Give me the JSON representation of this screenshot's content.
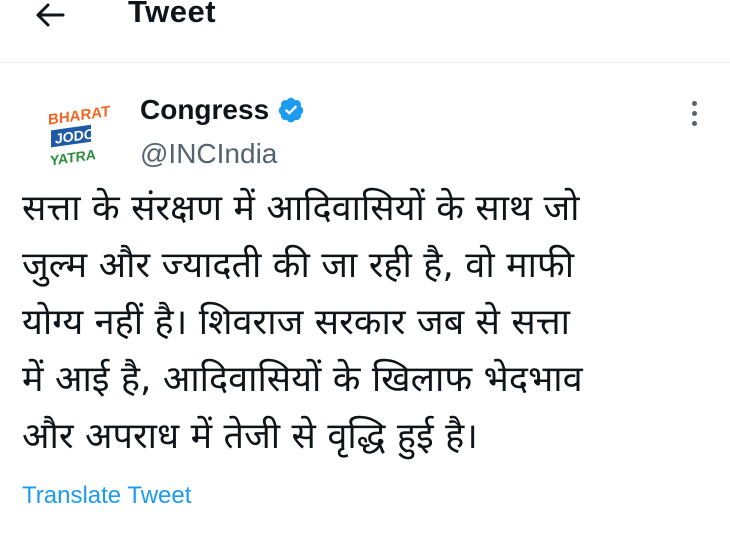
{
  "header": {
    "back_icon": "arrow-left-icon",
    "title": "Tweet"
  },
  "tweet": {
    "avatar": {
      "logo_text": [
        "BHARAT",
        "JODO",
        "YATRA"
      ],
      "colors": {
        "orange": "#f26522",
        "blue": "#1f5aa6",
        "green": "#2e8b3a"
      }
    },
    "display_name": "Congress",
    "verified_icon": "verified-badge-icon",
    "verified_color": "#1d9bf0",
    "handle": "@INCIndia",
    "more_icon": "more-vertical-icon",
    "text_lines": [
      "सत्ता के संरक्षण में आदिवासियों के साथ जो",
      "जुल्म और ज्यादती की जा रही है, वो माफी",
      "योग्य नहीं है। शिवराज सरकार जब से सत्ता",
      "में आई है, आदिवासियों के खिलाफ भेदभाव",
      "और अपराध में तेजी से वृद्धि हुई है।"
    ],
    "translate_label": "Translate Tweet",
    "link_color": "#1d9bf0"
  }
}
